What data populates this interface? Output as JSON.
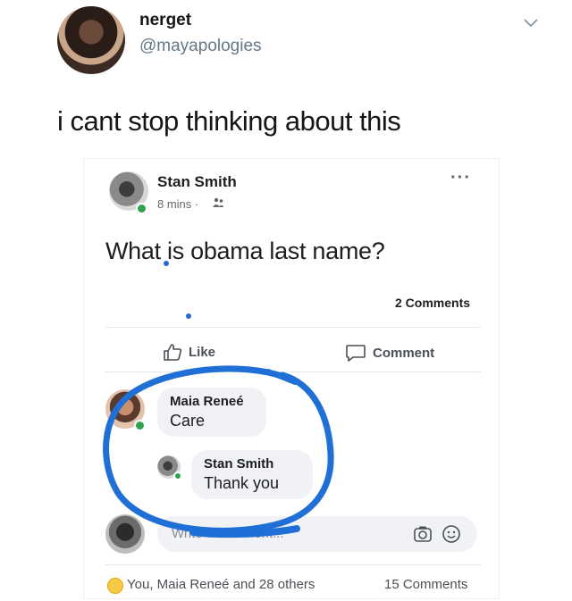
{
  "tweet": {
    "display_name": "nerget",
    "handle": "@mayapologies",
    "text": "i cant stop thinking about this"
  },
  "facebook_post": {
    "author": "Stan Smith",
    "time": "8 mins ·",
    "audience_icon": "friends-icon",
    "more_label": "···",
    "post_text": "What is obama last name?",
    "comment_count": "2 Comments",
    "actions": {
      "like_label": "Like",
      "comment_label": "Comment"
    },
    "comments": [
      {
        "name": "Maia Reneé",
        "text": "Care"
      },
      {
        "name": "Stan Smith",
        "text": "Thank you"
      }
    ],
    "write_placeholder": "Write a comment...",
    "footer": {
      "reactions": "You, Maia Reneé and 28 others",
      "comments_total": "15 Comments"
    }
  },
  "colors": {
    "circle_annotation": "#1f6fd6",
    "online_green": "#31a24c",
    "bubble_bg": "#f0f2f5"
  }
}
